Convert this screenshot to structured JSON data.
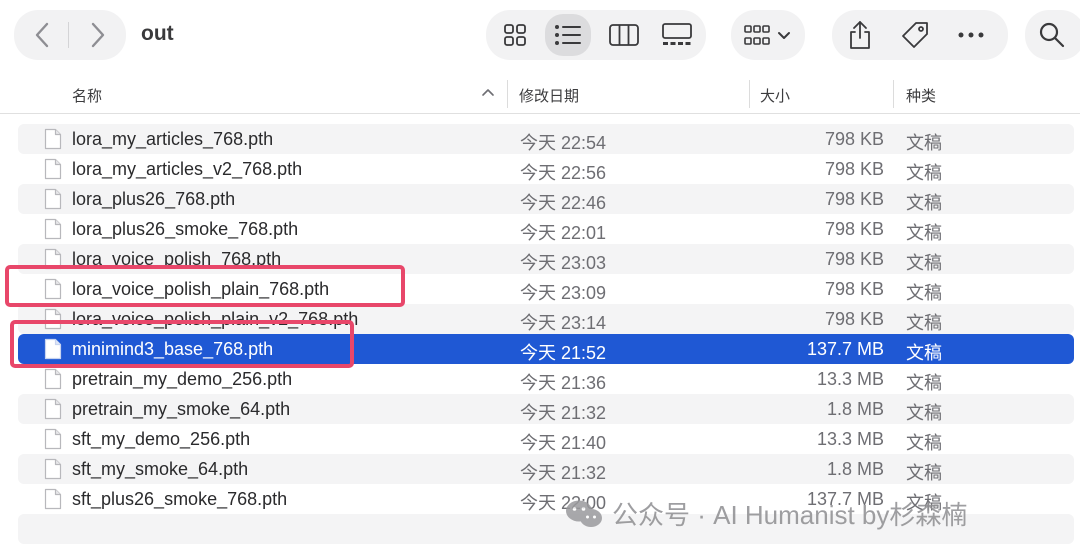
{
  "window": {
    "title": "out"
  },
  "toolbar": {
    "icons": [
      "chevron-left-icon",
      "chevron-right-icon",
      "icon-view-icon",
      "list-view-icon",
      "column-view-icon",
      "gallery-view-icon",
      "group-icon",
      "share-icon",
      "tag-icon",
      "more-icon",
      "search-icon"
    ]
  },
  "columns": {
    "name": "名称",
    "date": "修改日期",
    "size": "大小",
    "kind": "种类"
  },
  "files": [
    {
      "name": "lora_my_articles_768.pth",
      "date": "今天 22:54",
      "size": "798 KB",
      "kind": "文稿"
    },
    {
      "name": "lora_my_articles_v2_768.pth",
      "date": "今天 22:56",
      "size": "798 KB",
      "kind": "文稿"
    },
    {
      "name": "lora_plus26_768.pth",
      "date": "今天 22:46",
      "size": "798 KB",
      "kind": "文稿"
    },
    {
      "name": "lora_plus26_smoke_768.pth",
      "date": "今天 22:01",
      "size": "798 KB",
      "kind": "文稿"
    },
    {
      "name": "lora_voice_polish_768.pth",
      "date": "今天 23:03",
      "size": "798 KB",
      "kind": "文稿"
    },
    {
      "name": "lora_voice_polish_plain_768.pth",
      "date": "今天 23:09",
      "size": "798 KB",
      "kind": "文稿"
    },
    {
      "name": "lora_voice_polish_plain_v2_768.pth",
      "date": "今天 23:14",
      "size": "798 KB",
      "kind": "文稿"
    },
    {
      "name": "minimind3_base_768.pth",
      "date": "今天 21:52",
      "size": "137.7 MB",
      "kind": "文稿",
      "selected": true
    },
    {
      "name": "pretrain_my_demo_256.pth",
      "date": "今天 21:36",
      "size": "13.3 MB",
      "kind": "文稿"
    },
    {
      "name": "pretrain_my_smoke_64.pth",
      "date": "今天 21:32",
      "size": "1.8 MB",
      "kind": "文稿"
    },
    {
      "name": "sft_my_demo_256.pth",
      "date": "今天 21:40",
      "size": "13.3 MB",
      "kind": "文稿"
    },
    {
      "name": "sft_my_smoke_64.pth",
      "date": "今天 21:32",
      "size": "1.8 MB",
      "kind": "文稿"
    },
    {
      "name": "sft_plus26_smoke_768.pth",
      "date": "今天 22:00",
      "size": "137.7 MB",
      "kind": "文稿"
    }
  ],
  "watermark": {
    "text": "公众号 · AI Humanist by杉森楠"
  },
  "colors": {
    "selection": "#1f58d4",
    "highlight_box": "#e8476a",
    "alt_row": "#f4f4f5"
  }
}
